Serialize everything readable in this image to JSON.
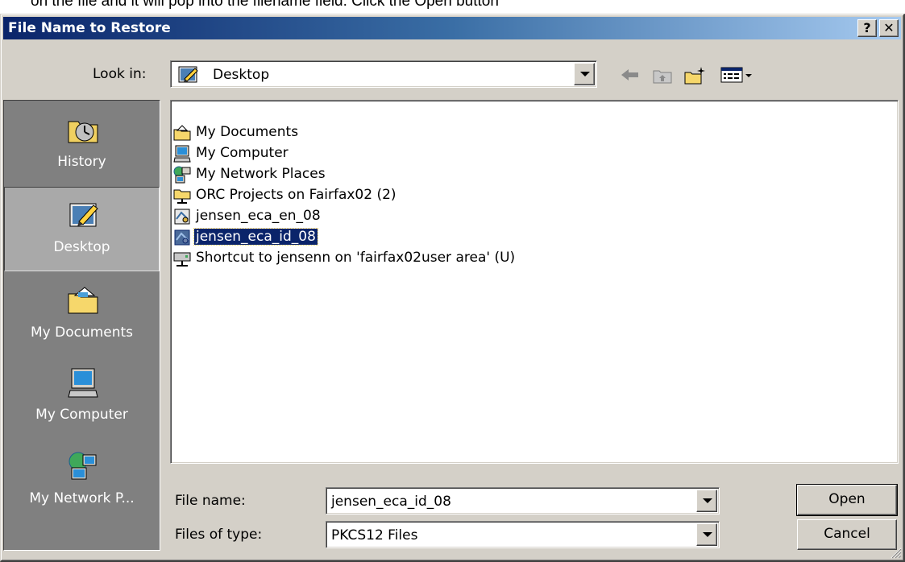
{
  "caption": "on the file and it will pop into the filename field. Click the Open button",
  "window": {
    "title": "File Name to Restore"
  },
  "title_buttons": {
    "help": "?",
    "close": "✕"
  },
  "look_in": {
    "label": "Look in:",
    "value": "Desktop"
  },
  "toolbar": {
    "tools": [
      "back-arrow-icon",
      "up-folder-icon",
      "new-folder-icon",
      "view-menu-icon"
    ]
  },
  "places": [
    {
      "label": "History",
      "icon": "history-icon",
      "active": false
    },
    {
      "label": "Desktop",
      "icon": "desktop-icon",
      "active": true
    },
    {
      "label": "My Documents",
      "icon": "my-documents-icon",
      "active": false
    },
    {
      "label": "My Computer",
      "icon": "my-computer-icon",
      "active": false
    },
    {
      "label": "My Network P...",
      "icon": "network-places-icon",
      "active": false
    }
  ],
  "files": [
    {
      "name": "My Documents",
      "icon": "my-documents-icon"
    },
    {
      "name": "My Computer",
      "icon": "my-computer-icon"
    },
    {
      "name": "My Network Places",
      "icon": "network-places-icon"
    },
    {
      "name": "ORC Projects on Fairfax02 (2)",
      "icon": "network-folder-icon"
    },
    {
      "name": "jensen_eca_en_08",
      "icon": "certificate-file-icon"
    },
    {
      "name": "jensen_eca_id_08",
      "icon": "certificate-file-icon",
      "selected": true
    },
    {
      "name": "Shortcut to jensenn on 'fairfax02user area' (U)",
      "icon": "network-drive-icon"
    }
  ],
  "file_name": {
    "label": "File name:",
    "value": "jensen_eca_id_08"
  },
  "file_type": {
    "label": "Files of type:",
    "value": "PKCS12 Files"
  },
  "buttons": {
    "open": "Open",
    "cancel": "Cancel"
  }
}
